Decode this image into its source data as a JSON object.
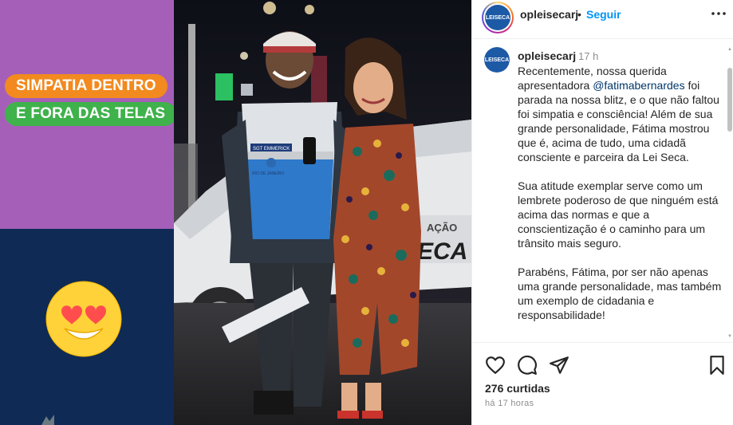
{
  "graphic": {
    "line1": "SIMPATIA DENTRO",
    "line2": "E FORA DAS TELAS",
    "colors": {
      "purple": "#a65fb9",
      "navy": "#0e2a55",
      "orange": "#f28a1f",
      "green": "#3fb24b"
    }
  },
  "photo": {
    "badge_text": "SGT EMMERICK",
    "vest_text": "RIO DE JANEIRO",
    "car_text_1": "AÇÃO",
    "car_text_2": "ECA"
  },
  "header": {
    "username": "opleisecarj",
    "separator": "•",
    "follow_label": "Seguir",
    "avatar_text": "LEISECA",
    "more_icon": "more-horizontal-icon"
  },
  "caption": {
    "username": "opleisecarj",
    "time": "17 h",
    "text_before": "Recentemente, nossa querida apresentadora ",
    "mention": "@fatimabernardes",
    "text_after": " foi parada na nossa blitz, e o que não faltou foi simpatia e consciência! Além de sua grande personalidade, Fátima mostrou que é, acima de tudo, uma cidadã consciente e parceira da Lei Seca.\n\nSua atitude exemplar serve como um lembrete poderoso de que ninguém está acima das normas e que a conscientização é o caminho para um trânsito mais seguro.\n\nParabéns, Fátima, por ser não apenas uma grande personalidade, mas também um exemplo de cidadania e responsabilidade!"
  },
  "actions": {
    "icons": [
      "heart-icon",
      "comment-icon",
      "share-icon",
      "bookmark-icon"
    ],
    "likes": "276 curtidas",
    "posted_ago": "há 17 horas"
  }
}
